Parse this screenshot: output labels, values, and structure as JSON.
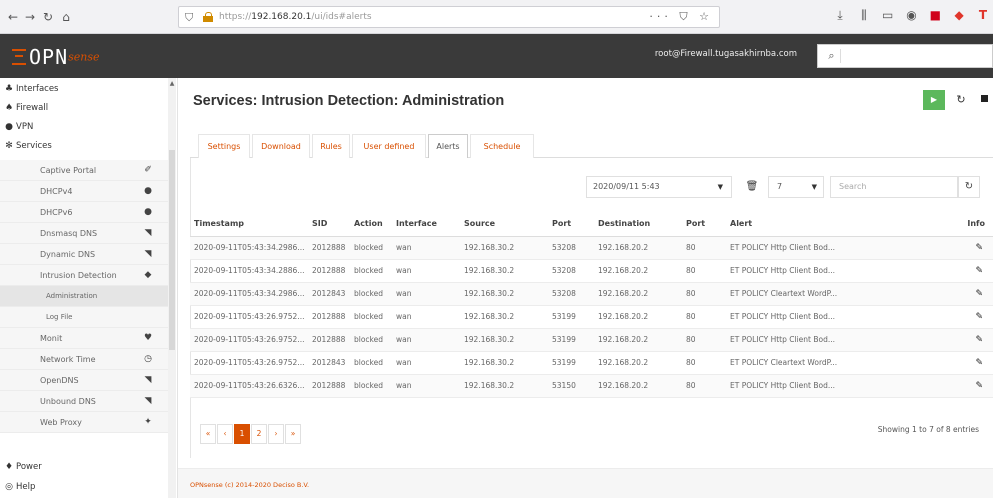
{
  "browser": {
    "back_icon": "back-arrow-icon",
    "forward_icon": "forward-arrow-icon",
    "reload_icon": "reload-icon",
    "home_icon": "home-icon",
    "url_prefix": "https://",
    "url_host": "192.168.20.1",
    "url_path": "/ui/ids#alerts",
    "page_actions": "··· ⛉ ☆"
  },
  "header": {
    "logo_main": "OPN",
    "logo_sub": "sense",
    "user": "root@Firewall.tugasakhirnba.com",
    "search_placeholder": ""
  },
  "sidebar": {
    "sections": [
      {
        "label": "Interfaces",
        "icon": "network-icon",
        "glyph": "♣"
      },
      {
        "label": "Firewall",
        "icon": "fire-icon",
        "glyph": "♠"
      },
      {
        "label": "VPN",
        "icon": "globe-icon",
        "glyph": "●"
      },
      {
        "label": "Services",
        "icon": "cog-icon",
        "glyph": "✻"
      }
    ],
    "service_items": [
      {
        "label": "Captive Portal",
        "glyph": "✐"
      },
      {
        "label": "DHCPv4",
        "glyph": "●"
      },
      {
        "label": "DHCPv6",
        "glyph": "●"
      },
      {
        "label": "Dnsmasq DNS",
        "glyph": "◥"
      },
      {
        "label": "Dynamic DNS",
        "glyph": "◥"
      },
      {
        "label": "Intrusion Detection",
        "glyph": "◆"
      }
    ],
    "ids_items": [
      {
        "label": "Administration"
      },
      {
        "label": "Log File"
      }
    ],
    "more_items": [
      {
        "label": "Monit",
        "glyph": "♥"
      },
      {
        "label": "Network Time",
        "glyph": "◷"
      },
      {
        "label": "OpenDNS",
        "glyph": "◥"
      },
      {
        "label": "Unbound DNS",
        "glyph": "◥"
      },
      {
        "label": "Web Proxy",
        "glyph": "✦"
      }
    ],
    "bottom_items": [
      {
        "label": "Power",
        "glyph": "♦"
      },
      {
        "label": "Help",
        "glyph": "◎"
      }
    ]
  },
  "main": {
    "title": "Services: Intrusion Detection: Administration",
    "play_glyph": "▶",
    "reload_glyph": "↻",
    "tabs": [
      "Settings",
      "Download",
      "Rules",
      "User defined",
      "Alerts",
      "Schedule"
    ],
    "active_tab": "Alerts",
    "toolbar": {
      "date": "2020/09/11 5:43",
      "rows_per_page": "7",
      "search_placeholder": "Search"
    },
    "table": {
      "columns": [
        "Timestamp",
        "SID",
        "Action",
        "Interface",
        "Source",
        "Port",
        "Destination",
        "Port",
        "Alert",
        "Info"
      ],
      "rows": [
        [
          "2020-09-11T05:43:34.2986...",
          "2012888",
          "blocked",
          "wan",
          "192.168.30.2",
          "53208",
          "192.168.20.2",
          "80",
          "ET POLICY Http Client Bod..."
        ],
        [
          "2020-09-11T05:43:34.2886...",
          "2012888",
          "blocked",
          "wan",
          "192.168.30.2",
          "53208",
          "192.168.20.2",
          "80",
          "ET POLICY Http Client Bod..."
        ],
        [
          "2020-09-11T05:43:34.2986...",
          "2012843",
          "blocked",
          "wan",
          "192.168.30.2",
          "53208",
          "192.168.20.2",
          "80",
          "ET POLICY Cleartext WordP..."
        ],
        [
          "2020-09-11T05:43:26.9752...",
          "2012888",
          "blocked",
          "wan",
          "192.168.30.2",
          "53199",
          "192.168.20.2",
          "80",
          "ET POLICY Http Client Bod..."
        ],
        [
          "2020-09-11T05:43:26.9752...",
          "2012888",
          "blocked",
          "wan",
          "192.168.30.2",
          "53199",
          "192.168.20.2",
          "80",
          "ET POLICY Http Client Bod..."
        ],
        [
          "2020-09-11T05:43:26.9752...",
          "2012843",
          "blocked",
          "wan",
          "192.168.30.2",
          "53199",
          "192.168.20.2",
          "80",
          "ET POLICY Cleartext WordP..."
        ],
        [
          "2020-09-11T05:43:26.6326...",
          "2012888",
          "blocked",
          "wan",
          "192.168.30.2",
          "53150",
          "192.168.20.2",
          "80",
          "ET POLICY Http Client Bod..."
        ]
      ]
    },
    "pager": [
      "«",
      "‹",
      "1",
      "2",
      "›",
      "»"
    ],
    "showing": "Showing 1 to 7 of 8 entries"
  },
  "footer": {
    "text": "OPNsense (c) 2014-2020 Deciso B.V."
  },
  "colors": {
    "brand_orange": "#d94f00",
    "header_bg": "#3a3a3a",
    "play_green": "#5cb85c"
  }
}
